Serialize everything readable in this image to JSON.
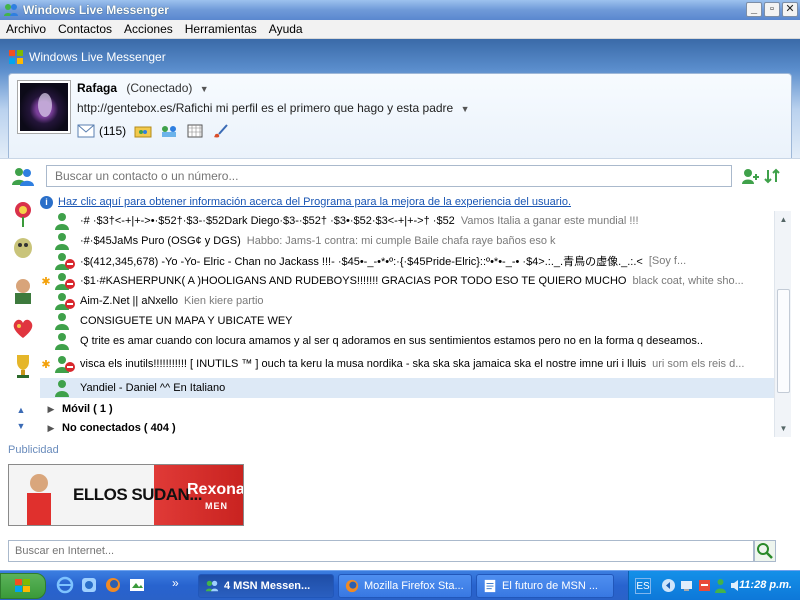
{
  "window": {
    "title": "Windows Live Messenger",
    "brand": "Windows Live Messenger",
    "controls": {
      "minimize": "_",
      "maximize": "▫",
      "close": "✕"
    }
  },
  "menu": [
    "Archivo",
    "Contactos",
    "Acciones",
    "Herramientas",
    "Ayuda"
  ],
  "profile": {
    "name": "Rafaga",
    "status": "(Conectado)",
    "personal_message": "http://gentebox.es/Rafichi mi perfil es el primero que hago y esta padre",
    "mail_count": "(115)"
  },
  "search": {
    "contact_placeholder": "Buscar un contacto o un número...",
    "web_placeholder": "Buscar en Internet..."
  },
  "info_link": "Haz clic aquí para obtener información acerca del Programa para la mejora de la experiencia del usuario.",
  "contacts": [
    {
      "starred": false,
      "blocked": false,
      "name": "·# ·$3†<-+|+->•·$52†·$3-·$52Dark Diego·$3-·$52† ·$3•·$52·$3<-+|+->† ·$52",
      "message": "Vamos Italia a ganar este mundial !!!"
    },
    {
      "starred": false,
      "blocked": false,
      "name": "·#·$45JaMs Puro (OSG¢ y DGS)",
      "message": "Habbo: Jams-1  contra: mi cumple  Baile chafa  raye baños  eso k"
    },
    {
      "starred": false,
      "blocked": true,
      "name": "·$(412,345,678) -Yo -Yo- Elric - Chan no Jackass !!!- ·$45•-_-•*•º:·{·$45Pride-Elric}::º•*•-_-•  ·$4>.:._.青鳥の虚像._.:.<",
      "message": "[Soy f..."
    },
    {
      "starred": true,
      "blocked": true,
      "name": "·$1·#KASHERPUNK( A )HOOLIGANS AND RUDEBOYS!!!!!!! GRACIAS POR TODO ESO TE QUIERO MUCHO",
      "message": "black coat, white sho..."
    },
    {
      "starred": false,
      "blocked": true,
      "name": "Aim-Z.Net || aNxello",
      "message": "Kien kiere partio"
    },
    {
      "starred": false,
      "blocked": false,
      "name": "CONSIGUETE UN MAPA Y UBICATE WEY",
      "message": ""
    },
    {
      "starred": false,
      "blocked": false,
      "name": "Q trite  es amar cuando con locura amamos y al ser q adoramos en sus sentimientos  estamos pero no en la forma q deseamos..",
      "message": ""
    },
    {
      "starred": true,
      "blocked": true,
      "name": "visca els inutils!!!!!!!!!!!   [ INUTILS  ™ ] ouch ta keru la musa nordika - ska ska ska jamaica ska el nostre imne uri i lluis",
      "message": "uri som els reis d..."
    },
    {
      "starred": false,
      "blocked": false,
      "name": "Yandiel - Daniel ^^ En Italiano",
      "message": ""
    }
  ],
  "groups": [
    {
      "label": "Móvil ( 1 )"
    },
    {
      "label": "No conectados ( 404 )"
    }
  ],
  "ads": {
    "label": "Publicidad",
    "headline": "ELLOS SUDAN...",
    "brand": "Rexona",
    "brand_sub": "MEN"
  },
  "taskbar": {
    "tasks": [
      "4 MSN Messen...",
      "Mozilla Firefox Sta...",
      "El futuro de MSN ..."
    ],
    "lang": "ES",
    "clock": "11:28 p.m.",
    "overflow": "»"
  },
  "colors": {
    "accent": "#3a6aa8",
    "link": "#1a56b4",
    "ad_red": "#e03a37"
  }
}
